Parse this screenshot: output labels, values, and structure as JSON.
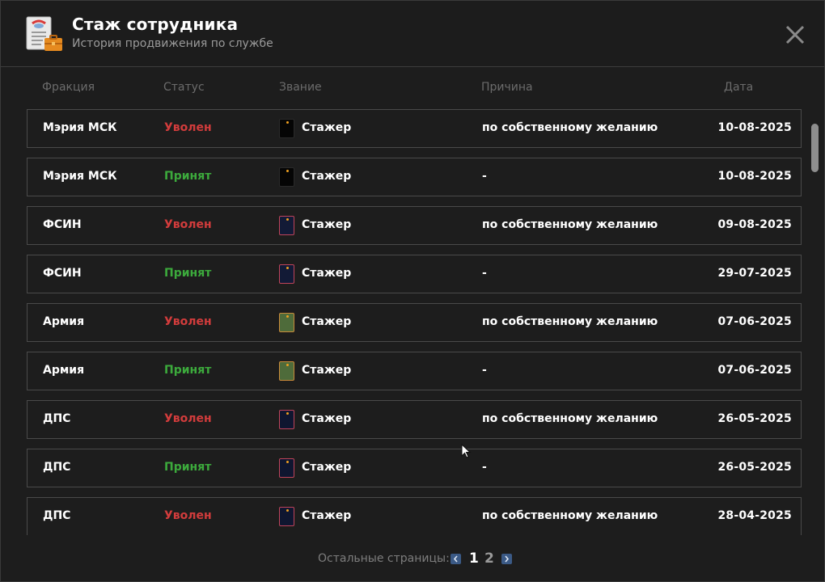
{
  "header": {
    "title": "Стаж сотрудника",
    "subtitle": "История продвижения по службе"
  },
  "columns": {
    "faction": "Фракция",
    "status": "Статус",
    "rank": "Звание",
    "reason": "Причина",
    "date": "Дата"
  },
  "colors": {
    "fired": "#d23c3c",
    "hired": "#3caa3c"
  },
  "rows": [
    {
      "faction": "Мэрия МСК",
      "status": "Уволен",
      "status_type": "fired",
      "rank": "Стажер",
      "rank_icon": "mayor-badge",
      "reason": "по собственному желанию",
      "date": "10-08-2025"
    },
    {
      "faction": "Мэрия МСК",
      "status": "Принят",
      "status_type": "hired",
      "rank": "Стажер",
      "rank_icon": "mayor-badge",
      "reason": "-",
      "date": "10-08-2025"
    },
    {
      "faction": "ФСИН",
      "status": "Уволен",
      "status_type": "fired",
      "rank": "Стажер",
      "rank_icon": "fsin-badge",
      "reason": "по собственному желанию",
      "date": "09-08-2025"
    },
    {
      "faction": "ФСИН",
      "status": "Принят",
      "status_type": "hired",
      "rank": "Стажер",
      "rank_icon": "fsin-badge",
      "reason": "-",
      "date": "29-07-2025"
    },
    {
      "faction": "Армия",
      "status": "Уволен",
      "status_type": "fired",
      "rank": "Стажер",
      "rank_icon": "army-badge",
      "reason": "по собственному желанию",
      "date": "07-06-2025"
    },
    {
      "faction": "Армия",
      "status": "Принят",
      "status_type": "hired",
      "rank": "Стажер",
      "rank_icon": "army-badge",
      "reason": "-",
      "date": "07-06-2025"
    },
    {
      "faction": "ДПС",
      "status": "Уволен",
      "status_type": "fired",
      "rank": "Стажер",
      "rank_icon": "dps-badge",
      "reason": "по собственному желанию",
      "date": "26-05-2025"
    },
    {
      "faction": "ДПС",
      "status": "Принят",
      "status_type": "hired",
      "rank": "Стажер",
      "rank_icon": "dps-badge",
      "reason": "-",
      "date": "26-05-2025"
    },
    {
      "faction": "ДПС",
      "status": "Уволен",
      "status_type": "fired",
      "rank": "Стажер",
      "rank_icon": "dps-badge",
      "reason": "по собственному желанию",
      "date": "28-04-2025"
    }
  ],
  "pager": {
    "label": "Остальные страницы:",
    "pages": [
      "1",
      "2"
    ],
    "current": "1"
  }
}
